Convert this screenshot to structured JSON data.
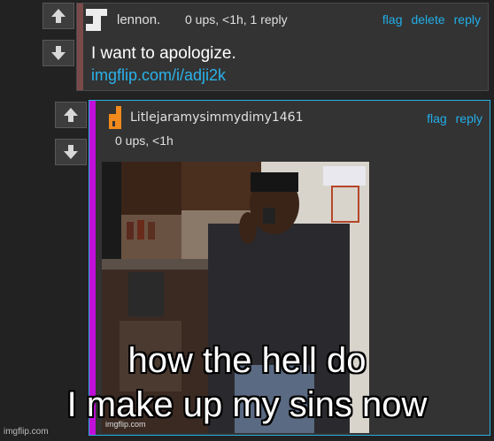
{
  "comment1": {
    "username": "lennon.",
    "meta": "0 ups, <1h, 1 reply",
    "actions": [
      "flag",
      "delete",
      "reply"
    ],
    "text": "I want to apologize.",
    "link": "imgflip.com/i/adji2k"
  },
  "comment2": {
    "username": "Litlejaramysimmydimy1461",
    "meta": "0 ups, <1h",
    "actions": [
      "flag",
      "reply"
    ]
  },
  "caption": {
    "line1": "how the hell do",
    "line2": "I make up my sins now"
  },
  "watermark": "imgflip.com",
  "colors": {
    "background": "#222222",
    "panel": "#333333",
    "link": "#22aee8",
    "reply_bar": "#c00fd8",
    "highlight_border": "#2ab0e0"
  },
  "icons": {
    "upvote": "arrow-up-icon",
    "downvote": "arrow-down-icon",
    "avatar1": "j-letter-icon",
    "avatar2": "orange-figure-icon"
  }
}
